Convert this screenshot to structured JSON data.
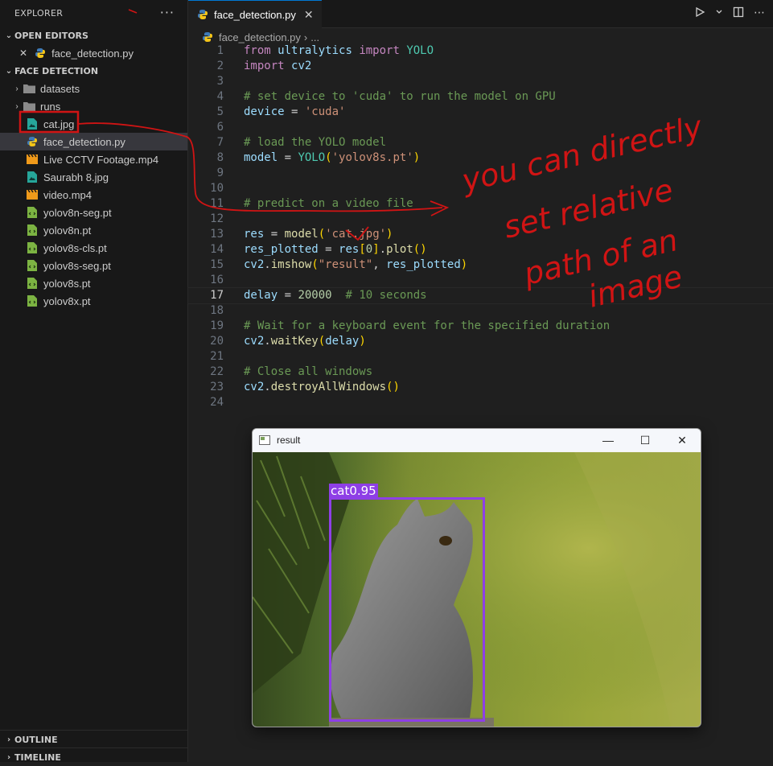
{
  "explorer": {
    "title": "EXPLORER",
    "more": "···",
    "open_editors": {
      "label": "OPEN EDITORS",
      "items": [
        {
          "name": "face_detection.py",
          "close": "✕"
        }
      ]
    },
    "project": {
      "label": "FACE DETECTION",
      "items": [
        {
          "name": "datasets",
          "type": "folder"
        },
        {
          "name": "runs",
          "type": "folder"
        },
        {
          "name": "cat.jpg",
          "type": "image"
        },
        {
          "name": "face_detection.py",
          "type": "python"
        },
        {
          "name": "Live CCTV Footage.mp4",
          "type": "video"
        },
        {
          "name": "Saurabh 8.jpg",
          "type": "image"
        },
        {
          "name": "video.mp4",
          "type": "video"
        },
        {
          "name": "yolov8n-seg.pt",
          "type": "model"
        },
        {
          "name": "yolov8n.pt",
          "type": "model"
        },
        {
          "name": "yolov8s-cls.pt",
          "type": "model"
        },
        {
          "name": "yolov8s-seg.pt",
          "type": "model"
        },
        {
          "name": "yolov8s.pt",
          "type": "model"
        },
        {
          "name": "yolov8x.pt",
          "type": "model"
        }
      ]
    },
    "outline": "OUTLINE",
    "timeline": "TIMELINE"
  },
  "editor": {
    "tab": {
      "label": "face_detection.py",
      "close": "✕"
    },
    "breadcrumb": {
      "file": "face_detection.py",
      "sep": "›",
      "more": "..."
    },
    "lines": [
      {
        "n": "1",
        "t": "from ultralytics import YOLO"
      },
      {
        "n": "2",
        "t": "import cv2"
      },
      {
        "n": "3",
        "t": ""
      },
      {
        "n": "4",
        "t": "# set device to 'cuda' to run the model on GPU"
      },
      {
        "n": "5",
        "t": "device = 'cuda'"
      },
      {
        "n": "6",
        "t": ""
      },
      {
        "n": "7",
        "t": "# load the YOLO model"
      },
      {
        "n": "8",
        "t": "model = YOLO('yolov8s.pt')"
      },
      {
        "n": "9",
        "t": ""
      },
      {
        "n": "10",
        "t": ""
      },
      {
        "n": "11",
        "t": "# predict on a video file"
      },
      {
        "n": "12",
        "t": ""
      },
      {
        "n": "13",
        "t": "res = model('cat.jpg')"
      },
      {
        "n": "14",
        "t": "res_plotted = res[0].plot()"
      },
      {
        "n": "15",
        "t": "cv2.imshow(\"result\", res_plotted)"
      },
      {
        "n": "16",
        "t": ""
      },
      {
        "n": "17",
        "t": "delay = 20000  # 10 seconds"
      },
      {
        "n": "18",
        "t": ""
      },
      {
        "n": "19",
        "t": "# Wait for a keyboard event for the specified duration"
      },
      {
        "n": "20",
        "t": "cv2.waitKey(delay)"
      },
      {
        "n": "21",
        "t": ""
      },
      {
        "n": "22",
        "t": "# Close all windows"
      },
      {
        "n": "23",
        "t": "cv2.destroyAllWindows()"
      },
      {
        "n": "24",
        "t": ""
      }
    ]
  },
  "result_window": {
    "title": "result",
    "minimize": "—",
    "maximize": "☐",
    "close": "✕",
    "detection_label": "cat0.95"
  },
  "annotation": {
    "lines": [
      "you can directly",
      "set relative",
      "path of an",
      "image"
    ]
  },
  "colors": {
    "accent": "#0078d4",
    "annotation": "#d01414",
    "bbox": "#8e3fe6"
  }
}
